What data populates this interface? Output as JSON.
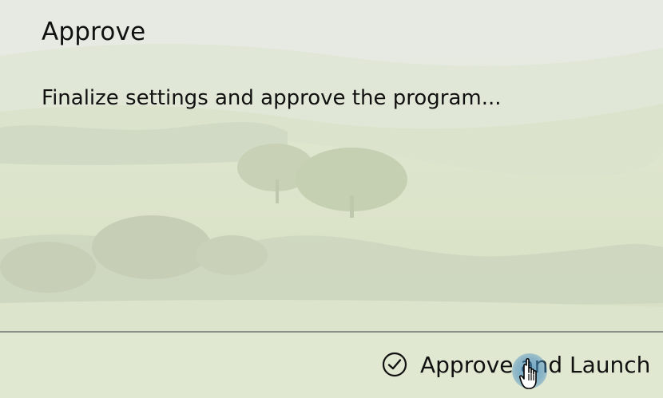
{
  "dialog": {
    "title": "Approve",
    "message": "Finalize settings and approve the program...",
    "primary_action_label": "Approve and Launch",
    "primary_action_icon": "check-circle-icon"
  },
  "cursor": {
    "icon": "hand-pointer-icon"
  },
  "colors": {
    "text": "#111111",
    "divider": "#8a8f87",
    "click_highlight": "#468cbe"
  }
}
